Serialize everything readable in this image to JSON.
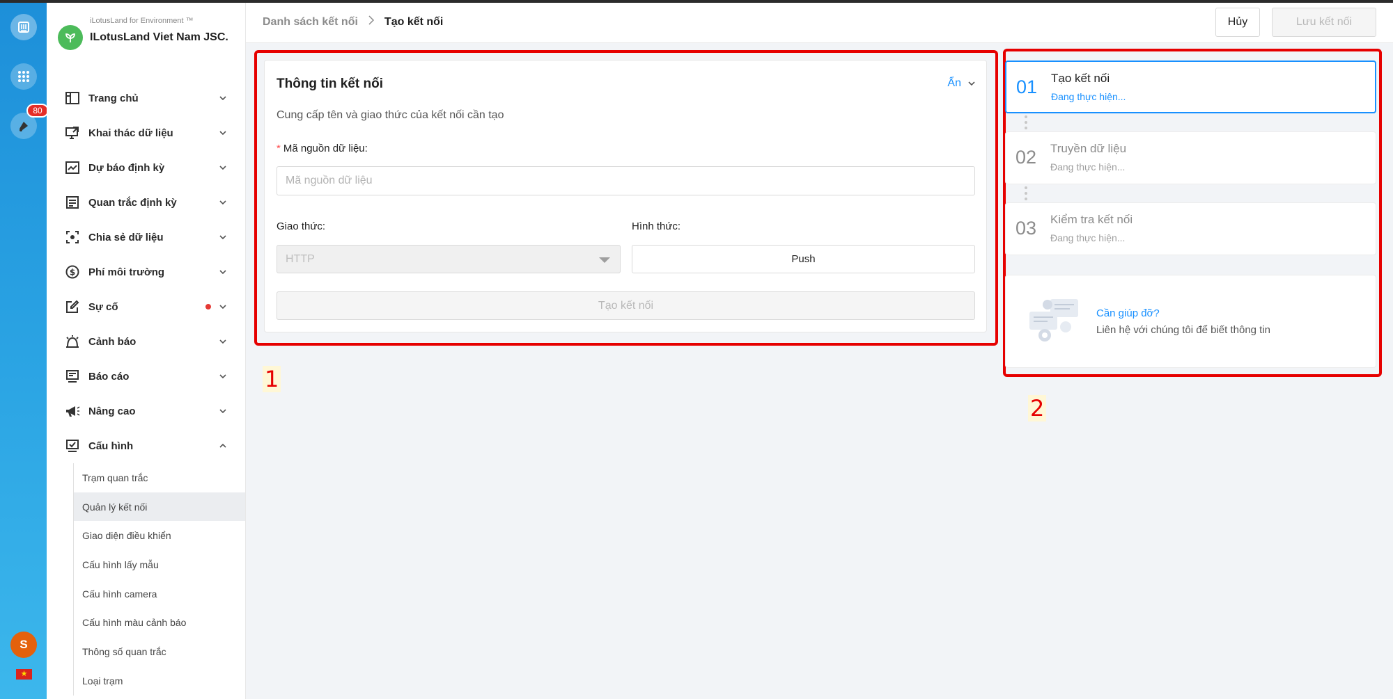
{
  "rail": {
    "notification_count": "80",
    "avatar_letter": "S"
  },
  "brand": {
    "tagline": "iLotusLand for Environment ™",
    "name": "ILotusLand Viet Nam JSC."
  },
  "menu": [
    {
      "label": "Trang chủ",
      "icon": "dashboard-icon"
    },
    {
      "label": "Khai thác dữ liệu",
      "icon": "monitor-export-icon"
    },
    {
      "label": "Dự báo định kỳ",
      "icon": "line-chart-icon"
    },
    {
      "label": "Quan trắc định kỳ",
      "icon": "list-form-icon"
    },
    {
      "label": "Chia sẻ dữ liệu",
      "icon": "focus-share-icon"
    },
    {
      "label": "Phí môi trường",
      "icon": "dollar-icon"
    },
    {
      "label": "Sự cố",
      "icon": "edit-icon"
    },
    {
      "label": "Cảnh báo",
      "icon": "alarm-bell-icon"
    },
    {
      "label": "Báo cáo",
      "icon": "report-monitor-icon"
    },
    {
      "label": "Nâng cao",
      "icon": "megaphone-icon"
    },
    {
      "label": "Cấu hình",
      "icon": "config-monitor-icon"
    }
  ],
  "submenu": [
    "Trạm quan trắc",
    "Quản lý kết nối",
    "Giao diện điều khiển",
    "Cấu hình lấy mẫu",
    "Cấu hình camera",
    "Cấu hình màu cảnh báo",
    "Thông số quan trắc",
    "Loại trạm"
  ],
  "header": {
    "crumb_parent": "Danh sách kết nối",
    "crumb_current": "Tạo kết nối",
    "cancel_label": "Hủy",
    "save_label": "Lưu kết nối"
  },
  "form": {
    "title": "Thông tin kết nối",
    "hide_label": "Ẩn",
    "description": "Cung cấp tên và giao thức của kết nối cần tạo",
    "source_label": "Mã nguồn dữ liệu:",
    "source_placeholder": "Mã nguồn dữ liệu",
    "protocol_label": "Giao thức:",
    "protocol_value": "HTTP",
    "form_label": "Hình thức:",
    "form_value": "Push",
    "create_label": "Tạo kết nối"
  },
  "steps": [
    {
      "no": "01",
      "title": "Tạo kết nối",
      "status": "Đang thực hiện..."
    },
    {
      "no": "02",
      "title": "Truyền dữ liệu",
      "status": "Đang thực hiện..."
    },
    {
      "no": "03",
      "title": "Kiểm tra kết nối",
      "status": "Đang thực hiện..."
    }
  ],
  "help": {
    "title": "Cần giúp đỡ?",
    "subtitle": "Liên hệ với chúng tôi để biết thông tin"
  },
  "annotations": {
    "label_1": "1",
    "label_2": "2"
  },
  "colors": {
    "accent": "#1890ff",
    "highlight_box": "#e60000",
    "rail": "#2aa3e3"
  }
}
